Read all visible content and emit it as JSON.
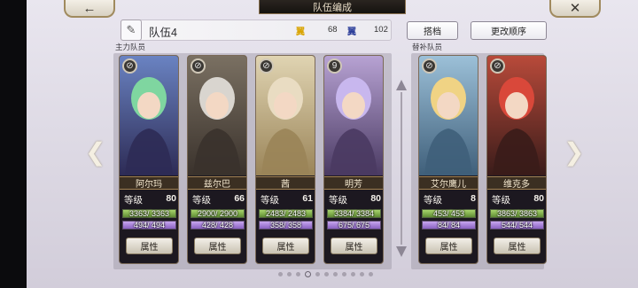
{
  "header": {
    "title": "队伍编成",
    "back_icon": "←",
    "close_icon": "✕"
  },
  "team": {
    "name": "队伍4",
    "stat_a_label": "翼",
    "stat_a_value": "68",
    "stat_b_label": "翼",
    "stat_b_value": "102"
  },
  "buttons": {
    "partner": "搭档",
    "change_order": "更改顺序"
  },
  "sections": {
    "main": "主力队员",
    "sub": "替补队员"
  },
  "members": [
    {
      "name": "阿尔玛",
      "badge": "⊘",
      "level_label": "等级",
      "level": "80",
      "hp": "3363/ 3363",
      "hp_pct": 1.0,
      "mp": "494/ 494",
      "mp_pct": 1.0,
      "attr_label": "属性",
      "bg": [
        "#6a83c2",
        "#2d2b55"
      ],
      "hair": "#7fd6a0"
    },
    {
      "name": "兹尔巴",
      "badge": "⊘",
      "level_label": "等级",
      "level": "66",
      "hp": "2900/ 2900",
      "hp_pct": 1.0,
      "mp": "428/ 428",
      "mp_pct": 1.0,
      "attr_label": "属性",
      "bg": [
        "#7a7062",
        "#3a322c"
      ],
      "hair": "#d9d5cf"
    },
    {
      "name": "茜",
      "badge": "⊘",
      "level_label": "等级",
      "level": "61",
      "hp": "2483/ 2483",
      "hp_pct": 1.0,
      "mp": "358/ 358",
      "mp_pct": 1.0,
      "attr_label": "属性",
      "bg": [
        "#e0d4b2",
        "#9a8458"
      ],
      "hair": "#e9dcc2"
    },
    {
      "name": "明芳",
      "badge": "9",
      "level_label": "等级",
      "level": "80",
      "hp": "3384/ 3384",
      "hp_pct": 1.0,
      "mp": "675/ 675",
      "mp_pct": 1.0,
      "attr_label": "属性",
      "bg": [
        "#b7a2d3",
        "#4a3a62"
      ],
      "hair": "#c8b7ee"
    },
    {
      "name": "艾尔鹰儿",
      "badge": "⊘",
      "level_label": "等级",
      "level": "8",
      "hp": "453/ 453",
      "hp_pct": 1.0,
      "mp": "84/ 84",
      "mp_pct": 1.0,
      "attr_label": "属性",
      "bg": [
        "#9cc0d8",
        "#3f5f7a"
      ],
      "hair": "#f0d384"
    },
    {
      "name": "维克多",
      "badge": "⊘",
      "level_label": "等级",
      "level": "80",
      "hp": "3863/ 3863",
      "hp_pct": 1.0,
      "mp": "544/ 544",
      "mp_pct": 1.0,
      "attr_label": "属性",
      "bg": [
        "#b84a3a",
        "#3a1c1a"
      ],
      "hair": "#d9483a"
    }
  ],
  "pagination": {
    "count": 11,
    "active": 3
  }
}
